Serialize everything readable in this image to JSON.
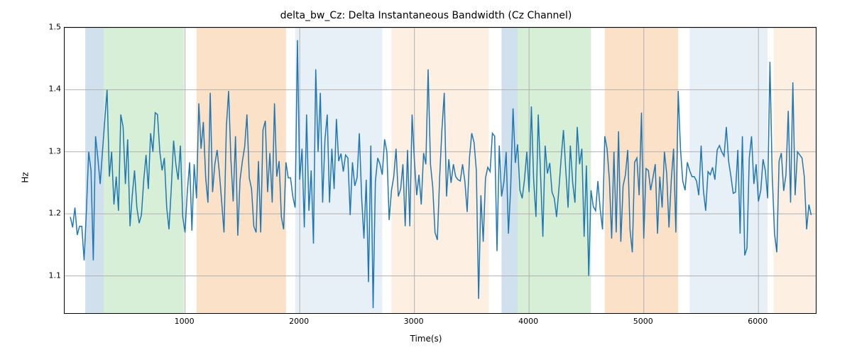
{
  "chart_data": {
    "type": "line",
    "title": "delta_bw_Cz: Delta Instantaneous Bandwidth (Cz Channel)",
    "xlabel": "Time(s)",
    "ylabel": "Hz",
    "xlim": [
      -50,
      6500
    ],
    "ylim": [
      1.04,
      1.5
    ],
    "xticks": [
      1000,
      2000,
      3000,
      4000,
      5000,
      6000
    ],
    "yticks": [
      1.1,
      1.2,
      1.3,
      1.4,
      1.5
    ],
    "bands": [
      {
        "x0": 130,
        "x1": 290,
        "color": "#a9c6de"
      },
      {
        "x0": 290,
        "x1": 990,
        "color": "#b6e0b6"
      },
      {
        "x0": 1100,
        "x1": 1880,
        "color": "#f7c99a"
      },
      {
        "x0": 1960,
        "x1": 2720,
        "color": "#d6e4f0"
      },
      {
        "x0": 2800,
        "x1": 3650,
        "color": "#fbe4cc"
      },
      {
        "x0": 3760,
        "x1": 3900,
        "color": "#a9c6de"
      },
      {
        "x0": 3900,
        "x1": 4540,
        "color": "#b6e0b6"
      },
      {
        "x0": 4660,
        "x1": 5300,
        "color": "#f7c99a"
      },
      {
        "x0": 5400,
        "x1": 6080,
        "color": "#d6e4f0"
      },
      {
        "x0": 6130,
        "x1": 6500,
        "color": "#fbe4cc"
      }
    ],
    "series": [
      {
        "name": "delta_bw_Cz",
        "x_start": 0,
        "x_step": 20,
        "values": [
          1.195,
          1.178,
          1.21,
          1.166,
          1.18,
          1.18,
          1.125,
          1.205,
          1.3,
          1.27,
          1.125,
          1.325,
          1.29,
          1.248,
          1.3,
          1.35,
          1.4,
          1.26,
          1.3,
          1.215,
          1.26,
          1.205,
          1.36,
          1.34,
          1.248,
          1.32,
          1.18,
          1.23,
          1.27,
          1.21,
          1.185,
          1.198,
          1.255,
          1.295,
          1.24,
          1.33,
          1.3,
          1.363,
          1.36,
          1.3,
          1.27,
          1.29,
          1.21,
          1.175,
          1.24,
          1.318,
          1.28,
          1.255,
          1.31,
          1.195,
          1.17,
          1.235,
          1.283,
          1.173,
          1.28,
          1.225,
          1.378,
          1.305,
          1.348,
          1.258,
          1.218,
          1.395,
          1.235,
          1.28,
          1.303,
          1.265,
          1.218,
          1.17,
          1.34,
          1.398,
          1.288,
          1.22,
          1.325,
          1.165,
          1.255,
          1.285,
          1.308,
          1.36,
          1.258,
          1.24,
          1.18,
          1.17,
          1.285,
          1.17,
          1.335,
          1.35,
          1.235,
          1.298,
          1.218,
          1.378,
          1.26,
          1.285,
          1.195,
          1.175,
          1.283,
          1.258,
          1.258,
          1.228,
          1.21,
          1.48,
          1.255,
          1.305,
          1.178,
          1.36,
          1.205,
          1.27,
          1.152,
          1.433,
          1.3,
          1.395,
          1.218,
          1.32,
          1.36,
          1.218,
          1.305,
          1.24,
          1.353,
          1.285,
          1.297,
          1.268,
          1.295,
          1.29,
          1.198,
          1.283,
          1.245,
          1.258,
          1.33,
          1.225,
          1.16,
          1.255,
          1.09,
          1.31,
          1.048,
          1.252,
          1.29,
          1.28,
          1.263,
          1.32,
          1.3,
          1.19,
          1.238,
          1.26,
          1.305,
          1.228,
          1.24,
          1.28,
          1.18,
          1.303,
          1.18,
          1.36,
          1.285,
          1.23,
          1.263,
          1.215,
          1.298,
          1.28,
          1.433,
          1.28,
          1.243,
          1.17,
          1.158,
          1.258,
          1.335,
          1.395,
          1.228,
          1.288,
          1.25,
          1.28,
          1.26,
          1.255,
          1.253,
          1.28,
          1.253,
          1.203,
          1.29,
          1.33,
          1.315,
          1.27,
          1.063,
          1.23,
          1.155,
          1.258,
          1.275,
          1.268,
          1.33,
          1.325,
          1.14,
          1.31,
          1.228,
          1.25,
          1.3,
          1.168,
          1.243,
          1.37,
          1.282,
          1.312,
          1.238,
          1.225,
          1.255,
          1.3,
          1.235,
          1.373,
          1.255,
          1.195,
          1.36,
          1.265,
          1.163,
          1.31,
          1.265,
          1.282,
          1.235,
          1.225,
          1.195,
          1.24,
          1.29,
          1.335,
          1.27,
          1.21,
          1.31,
          1.25,
          1.218,
          1.34,
          1.28,
          1.305,
          1.163,
          1.278,
          1.1,
          1.238,
          1.212,
          1.205,
          1.253,
          1.208,
          1.175,
          1.325,
          1.305,
          1.255,
          1.16,
          1.3,
          1.17,
          1.333,
          1.155,
          1.245,
          1.263,
          1.303,
          1.175,
          1.138,
          1.283,
          1.29,
          1.23,
          1.363,
          1.16,
          1.273,
          1.27,
          1.238,
          1.258,
          1.28,
          1.168,
          1.26,
          1.21,
          1.3,
          1.265,
          1.178,
          1.255,
          1.305,
          1.17,
          1.398,
          1.305,
          1.253,
          1.238,
          1.283,
          1.27,
          1.26,
          1.26,
          1.253,
          1.23,
          1.31,
          1.238,
          1.205,
          1.268,
          1.263,
          1.275,
          1.255,
          1.303,
          1.31,
          1.3,
          1.293,
          1.34,
          1.285,
          1.26,
          1.233,
          1.235,
          1.303,
          1.168,
          1.325,
          1.133,
          1.145,
          1.29,
          1.325,
          1.248,
          1.28,
          1.22,
          1.238,
          1.288,
          1.27,
          1.225,
          1.445,
          1.263,
          1.168,
          1.138,
          1.285,
          1.298,
          1.237,
          1.263,
          1.366,
          1.218,
          1.412,
          1.23,
          1.3,
          1.295,
          1.29,
          1.26,
          1.175,
          1.215,
          1.198
        ]
      }
    ]
  }
}
